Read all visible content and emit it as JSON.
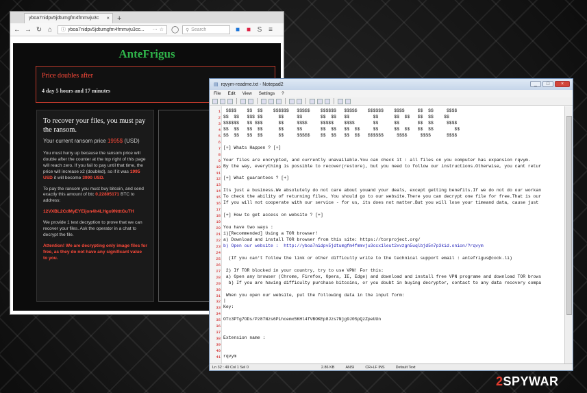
{
  "browser": {
    "tab_title": "yboa7nidpv5jdtumgfm4fmmvju3c",
    "url": "yboa7nidpv5jdtumgfm4fmmvju3cc...",
    "search_placeholder": "Search"
  },
  "ransom": {
    "title": "AnteFrigus",
    "price_header": "Price doubles after",
    "countdown": "4 day 5 hours and 17 minutes",
    "heading": "To recover your files, you must pay the ransom.",
    "current_price_label": "Your current ransom price",
    "current_price_value": "1995$",
    "current_price_unit": "(USD)",
    "warning_text": "You must hurry up because the ransom price will double after the counter at the top right of this page will reach zero. If you fail to pay until that time, the price will increase x2 (doubled), so if it was",
    "warning_price1": "1995 USD",
    "warning_mid": "it will become",
    "warning_price2": "3990 USD.",
    "pay_text": "To pay the ransom you must buy bitcoin, and send exactly this amount of btc",
    "btc_amount": "0.22805171",
    "pay_text2": "BTC to address:",
    "btc_address": "12VXBL2CdMyEYEijon4h4LHgo9NtttGuTH",
    "decrypt_text": "We provide 1 test decryption to prove that we can recover your files. Ask the operator in a chat to decrypt the file.",
    "attention_text": "Attention! We are decrypting only image files for free, as they do not have any significant value to you."
  },
  "notepad": {
    "title": "rqvym-readme.txt - Notepad2",
    "menu": [
      "File",
      "Edit",
      "View",
      "Settings",
      "?"
    ],
    "lines": [
      {
        "n": "1",
        "t": " $$$$    $$  $$    $$$$$$   $$$$$    $$$$$$   $$$$$    $$$$$$    $$$$     $$  $$     $$$$"
      },
      {
        "n": "2",
        "t": "$$  $$   $$$ $$      $$     $$       $$  $$   $$         $$      $$  $$   $$  $$    $$"
      },
      {
        "n": "3",
        "t": "$$$$$$   $$ $$$      $$     $$$$     $$$$$    $$$$       $$      $$       $$  $$     $$$$"
      },
      {
        "n": "4",
        "t": "$$  $$   $$  $$      $$     $$       $$  $$   $$  $$     $$      $$  $$   $$  $$        $$"
      },
      {
        "n": "5",
        "t": "$$  $$   $$  $$      $$     $$$$$    $$  $$   $$  $$   $$$$$$     $$$$     $$$$      $$$$"
      },
      {
        "n": "6",
        "t": ""
      },
      {
        "n": "7",
        "t": "[+] Whats Happen ? [+]"
      },
      {
        "n": "8",
        "t": ""
      },
      {
        "n": "9",
        "t": "Your files are encrypted, and currently unavailable.You can check it : all files on you computer has expansion rqvym."
      },
      {
        "n": "10",
        "t": "By the way, everything is possible to recover(restore), but you need to follow our instructions.Otherwise, you cant retur"
      },
      {
        "n": "11",
        "t": ""
      },
      {
        "n": "12",
        "t": "[+] What guarantees ? [+]"
      },
      {
        "n": "13",
        "t": ""
      },
      {
        "n": "14",
        "t": "Its just a business.We absolutely do not care about youand your deals, except getting benefits.If we do not do our workan"
      },
      {
        "n": "15",
        "t": "To check the ability of returning files, You should go to our website.There you can decrypt one file for free.That is our"
      },
      {
        "n": "16",
        "t": "If you will not cooperate with our service - for us, its does not matter.But you will lose your timeand data, cause just"
      },
      {
        "n": "17",
        "t": ""
      },
      {
        "n": "18",
        "t": "[+] How to get access on website ? [+]"
      },
      {
        "n": "19",
        "t": ""
      },
      {
        "n": "20",
        "t": "You have two ways :"
      },
      {
        "n": "21",
        "t": "1)[Recommended] Using a TOR browser!"
      },
      {
        "n": "22",
        "t": "a) Download and install TOR browser from this site: https://torproject.org/"
      },
      {
        "n": "23",
        "t": "b) Open our website :  http://yboa7nidpv5jdtumgfm4fmmvju3ccx1leut2xvzgn5uqlbjd5n7p3kid.onion/?rqvym"
      },
      {
        "n": "24",
        "t": ""
      },
      {
        "n": "25",
        "t": "  (If you can't follow the link or other difficulty write to the technical support email : antefrigus@cock.li)"
      },
      {
        "n": "26",
        "t": ""
      },
      {
        "n": "27",
        "t": " 2) If TOR blocked in your country, try to use VPN! For this:"
      },
      {
        "n": "28",
        "t": " a) Open any browser (Chrome, Firefox, Opera, IE, Edge) and download and install free VPN programe and download TOR brows"
      },
      {
        "n": "29",
        "t": "  b) If you are having difficulty purchase bitcoins, or you doubt in buying decryptor, contact to any data recovery compa"
      },
      {
        "n": "30",
        "t": ""
      },
      {
        "n": "31",
        "t": " When you open our website, put the following data in the input form:"
      },
      {
        "n": "32",
        "t": "|"
      },
      {
        "n": "33",
        "t": "Key:"
      },
      {
        "n": "34",
        "t": ""
      },
      {
        "n": "35",
        "t": "OTc3PTg7ODs/Pz87Nzs6Pihcemx5KHl4fVBOKEp8Jzs7Njg9J0SpQzZpeUUn"
      },
      {
        "n": "36",
        "t": ""
      },
      {
        "n": "37",
        "t": ""
      },
      {
        "n": "38",
        "t": "Extension name :"
      },
      {
        "n": "39",
        "t": ""
      },
      {
        "n": "40",
        "t": ""
      },
      {
        "n": "41",
        "t": "rqvym"
      }
    ],
    "status": {
      "position": "Ln 32 : 49   Col 1   Sel 0",
      "size": "2.86 KB",
      "encoding": "ANSI",
      "eol": "CR+LF   INS",
      "scheme": "Default Text"
    }
  },
  "watermark": {
    "num": "2",
    "text": "SPYWAR"
  },
  "icons": [
    "back-arrow-icon",
    "forward-arrow-icon",
    "reload-icon",
    "home-icon",
    "info-icon",
    "more-icon",
    "bookmark-icon",
    "shield-icon",
    "search-icon"
  ]
}
